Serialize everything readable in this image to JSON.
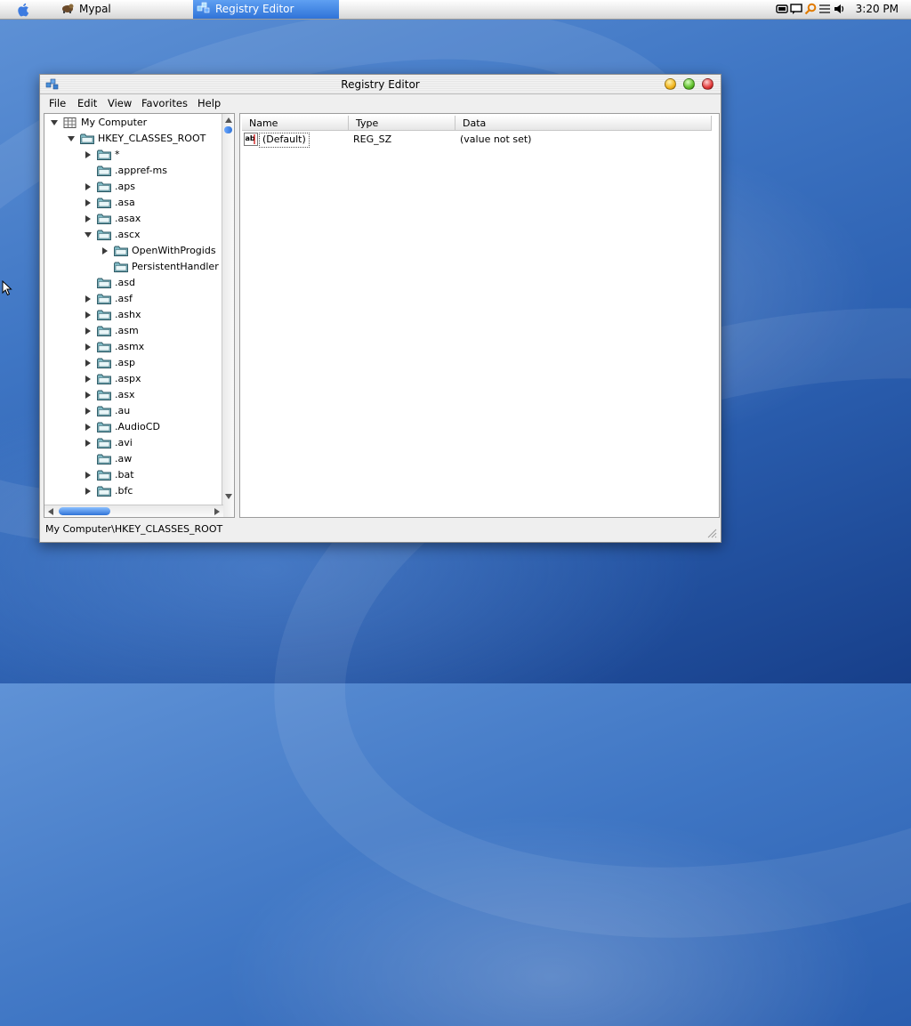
{
  "menubar": {
    "tasks": [
      {
        "label": "Mypal",
        "icon": "mypal-icon"
      },
      {
        "label": "Registry Editor",
        "icon": "registry-editor-icon",
        "active": true
      }
    ],
    "tray_icons": [
      "monitor-icon",
      "chat-icon",
      "search-key-icon",
      "lines-icon",
      "speaker-icon"
    ],
    "clock": "3:20 PM"
  },
  "window": {
    "title": "Registry Editor",
    "menu": [
      "File",
      "Edit",
      "View",
      "Favorites",
      "Help"
    ],
    "tree": [
      {
        "label": "My Computer",
        "level": 0,
        "state": "expanded",
        "icon": "computer-icon"
      },
      {
        "label": "HKEY_CLASSES_ROOT",
        "level": 1,
        "state": "expanded",
        "icon": "open-folder-icon"
      },
      {
        "label": "*",
        "level": 2,
        "state": "collapsed"
      },
      {
        "label": ".appref-ms",
        "level": 2,
        "state": "leaf"
      },
      {
        "label": ".aps",
        "level": 2,
        "state": "collapsed"
      },
      {
        "label": ".asa",
        "level": 2,
        "state": "collapsed"
      },
      {
        "label": ".asax",
        "level": 2,
        "state": "collapsed"
      },
      {
        "label": ".ascx",
        "level": 2,
        "state": "expanded"
      },
      {
        "label": "OpenWithProgids",
        "level": 3,
        "state": "collapsed"
      },
      {
        "label": "PersistentHandler",
        "level": 3,
        "state": "leaf"
      },
      {
        "label": ".asd",
        "level": 2,
        "state": "leaf"
      },
      {
        "label": ".asf",
        "level": 2,
        "state": "collapsed"
      },
      {
        "label": ".ashx",
        "level": 2,
        "state": "collapsed"
      },
      {
        "label": ".asm",
        "level": 2,
        "state": "collapsed"
      },
      {
        "label": ".asmx",
        "level": 2,
        "state": "collapsed"
      },
      {
        "label": ".asp",
        "level": 2,
        "state": "collapsed"
      },
      {
        "label": ".aspx",
        "level": 2,
        "state": "collapsed"
      },
      {
        "label": ".asx",
        "level": 2,
        "state": "collapsed"
      },
      {
        "label": ".au",
        "level": 2,
        "state": "collapsed"
      },
      {
        "label": ".AudioCD",
        "level": 2,
        "state": "collapsed"
      },
      {
        "label": ".avi",
        "level": 2,
        "state": "collapsed"
      },
      {
        "label": ".aw",
        "level": 2,
        "state": "leaf"
      },
      {
        "label": ".bat",
        "level": 2,
        "state": "collapsed"
      },
      {
        "label": ".bfc",
        "level": 2,
        "state": "collapsed"
      }
    ],
    "columns": [
      "Name",
      "Type",
      "Data"
    ],
    "values": [
      {
        "name": "(Default)",
        "type": "REG_SZ",
        "data": "(value not set)"
      }
    ],
    "status": "My Computer\\HKEY_CLASSES_ROOT"
  },
  "colors": {
    "accent": "#2f73d8",
    "folder": "#7fb9c4"
  }
}
